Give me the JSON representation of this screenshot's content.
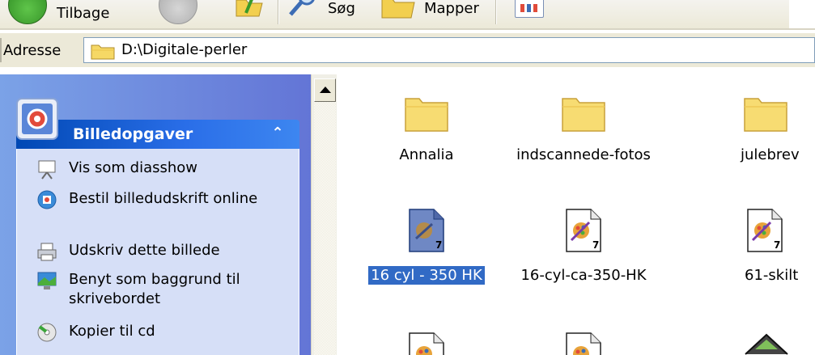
{
  "toolbar": {
    "back_label": "Tilbage",
    "search_label": "Søg",
    "folders_label": "Mapper"
  },
  "address": {
    "label": "Adresse",
    "value": "D:\\Digitale-perler"
  },
  "task_pane": {
    "title": "Billedopgaver",
    "items": [
      {
        "label": "Vis som diasshow",
        "icon": "slideshow-icon"
      },
      {
        "label": "Bestil billedudskrift online",
        "icon": "order-prints-icon"
      },
      {
        "label": "Udskriv dette billede",
        "icon": "print-icon"
      },
      {
        "label": "Benyt som baggrund til skrivebordet",
        "icon": "desktop-background-icon"
      },
      {
        "label": "Kopier til cd",
        "icon": "copy-to-cd-icon"
      }
    ]
  },
  "files": [
    {
      "name": "Annalia",
      "type": "folder",
      "selected": false
    },
    {
      "name": "indscannede-fotos",
      "type": "folder",
      "selected": false
    },
    {
      "name": "julebrev",
      "type": "folder",
      "selected": false
    },
    {
      "name": "16 cyl - 350 HK",
      "type": "paint-image",
      "selected": true
    },
    {
      "name": "16-cyl-ca-350-HK",
      "type": "paint-image",
      "selected": false
    },
    {
      "name": "61-skilt",
      "type": "paint-image",
      "selected": false
    }
  ],
  "colors": {
    "selection": "#316ac5",
    "task_header": "#0048b4",
    "task_body": "#d6dff7",
    "pane_gradient_start": "#7ba2e7",
    "pane_gradient_end": "#6375d6"
  }
}
